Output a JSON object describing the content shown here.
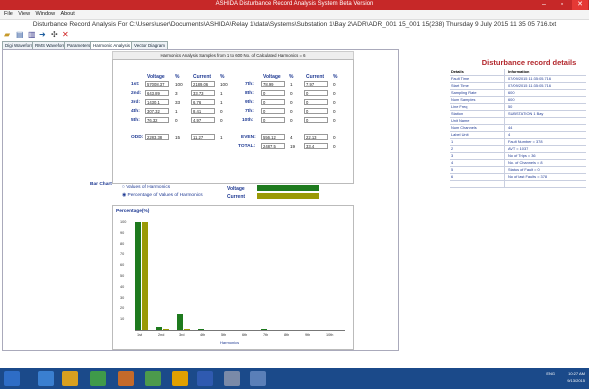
{
  "window": {
    "title": "ASHIDA Disturbance Record Analysis System Beta Version",
    "controls": [
      "‒",
      "▫",
      "✕"
    ]
  },
  "menu": [
    "File",
    "View",
    "Window",
    "About"
  ],
  "headline": "Disturbance Record Analysis For C:\\Users\\user\\Documents\\ASHIDA\\Relay 1\\data\\Systems\\Substation 1\\Bay 2\\ADR\\ADR_001 15_001 15(238) Thursday 9 July 2015 11 35 05 716.txt",
  "toolbar_icons": [
    "open-icon",
    "save-icon",
    "chart-icon",
    "arrow-icon",
    "cursor-icon",
    "close-icon"
  ],
  "tabs": [
    "Digi Waveform",
    "RMS Waveform",
    "Parameters",
    "Harmonic Analysis",
    "Vector Diagram"
  ],
  "active_tab": 3,
  "banner": "Harmonics Analysis Samples from 1 to 600 No. of Calculated Harmonics = 6",
  "table_headers": {
    "voltage": "Voltage",
    "pct": "%",
    "current": "Current",
    "pct2": "%"
  },
  "harmonics_left": [
    {
      "label": "1st:",
      "voltage": "57008.37",
      "vpct": "100",
      "current": "2189.06",
      "cpct": "100"
    },
    {
      "label": "2nd:",
      "voltage": "643.89",
      "vpct": "3",
      "current": "33.73",
      "cpct": "1"
    },
    {
      "label": "3rd:",
      "voltage": "1430.1",
      "vpct": "33",
      "current": "6.76",
      "cpct": "1"
    },
    {
      "label": "4th:",
      "voltage": "307.32",
      "vpct": "1",
      "current": "8.41",
      "cpct": "0"
    },
    {
      "label": "5th:",
      "voltage": "76.32",
      "vpct": "0",
      "current": "4.97",
      "cpct": "0"
    }
  ],
  "harmonics_right": [
    {
      "label": "7th:",
      "voltage": "78.99",
      "vpct": "1",
      "current": "7.97",
      "cpct": "0"
    },
    {
      "label": "8th:",
      "voltage": "0",
      "vpct": "0",
      "current": "0",
      "cpct": "0"
    },
    {
      "label": "9th:",
      "voltage": "0",
      "vpct": "0",
      "current": "0",
      "cpct": "0"
    },
    {
      "label": "7th:",
      "voltage": "0",
      "vpct": "0",
      "current": "0",
      "cpct": "0"
    },
    {
      "label": "10th:",
      "voltage": "0",
      "vpct": "0",
      "current": "0",
      "cpct": "0"
    }
  ],
  "odd": {
    "label": "ODD:",
    "voltage": "2283.38",
    "vpct": "15",
    "current": "11.27",
    "cpct": "1"
  },
  "even": {
    "label": "EVEN:",
    "voltage": "556.12",
    "vpct": "4",
    "current": "22.13",
    "cpct": "0"
  },
  "total": {
    "label": "TOTAL:",
    "voltage": "2487.5",
    "vpct": "19",
    "current": "33.4",
    "cpct": "0"
  },
  "bar_chart_section": {
    "title": "Bar Chart",
    "option_values": "Values of Harmonics",
    "option_percent": "Percentage of Values of Harmonics",
    "selected": "percent",
    "legend_voltage": "Voltage",
    "legend_current": "Current"
  },
  "colors": {
    "voltage": "#1e7a1e",
    "current": "#9a9a06",
    "title_bar": "#c62828",
    "taskbar": "#1b4a8a"
  },
  "chart_data": {
    "type": "bar",
    "ylabel": "Percentage(%)",
    "xlabel": "Harmonics",
    "categories": [
      "1st",
      "2nd",
      "3rd",
      "4th",
      "5th",
      "6th",
      "7th",
      "8th",
      "9th",
      "10th"
    ],
    "ylim": [
      0,
      100
    ],
    "yticks": [
      10,
      20,
      30,
      40,
      50,
      60,
      70,
      80,
      90,
      100
    ],
    "series": [
      {
        "name": "Voltage",
        "values": [
          100,
          3,
          15,
          1,
          0,
          0,
          1,
          0,
          0,
          0
        ]
      },
      {
        "name": "Current",
        "values": [
          100,
          1,
          1,
          0,
          0,
          0,
          0,
          0,
          0,
          0
        ]
      }
    ]
  },
  "details": {
    "title": "Disturbance record details",
    "head": {
      "c1": "Details",
      "c2": "Information"
    },
    "rows": [
      {
        "k": "Fault Time",
        "v": "07/09/2015 11:35:05.716"
      },
      {
        "k": "Start Time",
        "v": "07/09/2015 11:35:05.716"
      },
      {
        "k": "Sampling Rate",
        "v": "600"
      },
      {
        "k": "Num Samples",
        "v": "600"
      },
      {
        "k": "Line Freq",
        "v": "50"
      },
      {
        "k": "Station",
        "v": "SUBSTATION 1 Bay"
      },
      {
        "k": "Unit Name",
        "v": ""
      },
      {
        "k": "Num Channels",
        "v": "44"
      },
      {
        "k": "Label Unit",
        "v": "4"
      },
      {
        "k": "1",
        "v": "Fault Number = 378"
      },
      {
        "k": "2",
        "v": "AVT = 1037"
      },
      {
        "k": "3",
        "v": "No of Trips = 36"
      },
      {
        "k": "4",
        "v": "No. of Channels = 8"
      },
      {
        "k": "5",
        "v": "Status of Fault = 0"
      },
      {
        "k": "6",
        "v": "No of last Faults = 378"
      },
      {
        "k": "",
        "v": ""
      }
    ]
  },
  "taskbar": {
    "clock_time": "10:27 AM",
    "clock_date": "9/13/2015",
    "lang": "ENG"
  }
}
